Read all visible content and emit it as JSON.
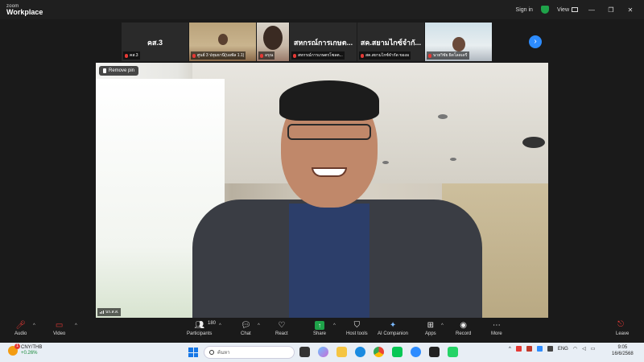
{
  "titlebar": {
    "brand_small": "zoom",
    "brand_big": "Workplace",
    "sign_in": "Sign in",
    "view": "View"
  },
  "gallery": {
    "tiles": [
      {
        "big": "คส.3",
        "label": "คส.3"
      },
      {
        "big": "",
        "label": "ศูนย์ 3 ปทุมธานี(บอพัล 1.1)"
      },
      {
        "big": "",
        "label": "อรุณ"
      },
      {
        "big": "สหกรณ์การเกษต...",
        "label": "สหกรณ์การเกษตรโซลต..."
      },
      {
        "big": "สค.สยามไกซ์จำกั...",
        "label": "สค.สยามไกซ์จำกัด ของอ"
      },
      {
        "big": "",
        "label": "นายวิชัย ผิดโลดเดรี"
      }
    ]
  },
  "main_video": {
    "remove_pin": "Remove pin",
    "name": "นร.ส.ส."
  },
  "toolbar": {
    "audio": "Audio",
    "video": "Video",
    "participants": "Participants",
    "participant_count": "180",
    "chat": "Chat",
    "react": "React",
    "share": "Share",
    "host_tools": "Host tools",
    "ai_companion": "AI Companion",
    "apps": "Apps",
    "record": "Record",
    "more": "More",
    "leave": "Leave"
  },
  "taskbar": {
    "stock_symbol": "CNY/THB",
    "stock_change": "+0.26%",
    "stock_badge": "1",
    "search_placeholder": "ค้นหา",
    "lang": "ENG",
    "time": "9:05",
    "date": "16/6/2568"
  },
  "colors": {
    "accent": "#2d8cff",
    "mute_red": "#e53935",
    "share_green": "#1fa34a"
  }
}
